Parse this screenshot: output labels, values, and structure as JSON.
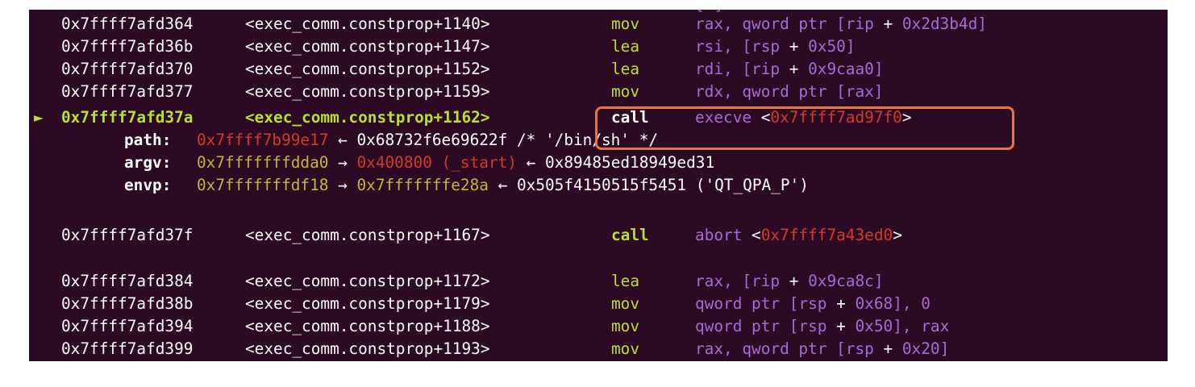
{
  "colors": {
    "background": "#2c0a23",
    "text": "#ffffff",
    "purple": "#a66bd6",
    "red": "#d23a2a",
    "yellow": "#c6b43a",
    "green": "#b8e02c",
    "highlight_box": "#e3753f"
  },
  "cutoff_text": "[ ]",
  "block1": [
    {
      "addr": "0x7ffff7afd364",
      "sym": "<exec_comm.constprop+1140>",
      "mn": "mov",
      "ops": [
        {
          "t": "rax, ",
          "c": "reg"
        },
        {
          "t": "qword ptr [",
          "c": "reg"
        },
        {
          "t": "rip",
          "c": "reg"
        },
        {
          "t": " + ",
          "c": "text"
        },
        {
          "t": "0x2d3b4d",
          "c": "num"
        },
        {
          "t": "]",
          "c": "reg"
        }
      ]
    },
    {
      "addr": "0x7ffff7afd36b",
      "sym": "<exec_comm.constprop+1147>",
      "mn": "lea",
      "ops": [
        {
          "t": "rsi, [",
          "c": "reg"
        },
        {
          "t": "rsp",
          "c": "reg"
        },
        {
          "t": " + ",
          "c": "text"
        },
        {
          "t": "0x50",
          "c": "num"
        },
        {
          "t": "]",
          "c": "reg"
        }
      ]
    },
    {
      "addr": "0x7ffff7afd370",
      "sym": "<exec_comm.constprop+1152>",
      "mn": "lea",
      "ops": [
        {
          "t": "rdi, [",
          "c": "reg"
        },
        {
          "t": "rip",
          "c": "reg"
        },
        {
          "t": " + ",
          "c": "text"
        },
        {
          "t": "0x9caa0",
          "c": "num"
        },
        {
          "t": "]",
          "c": "reg"
        }
      ]
    },
    {
      "addr": "0x7ffff7afd377",
      "sym": "<exec_comm.constprop+1159>",
      "mn": "mov",
      "ops": [
        {
          "t": "rdx, qword ptr [rax]",
          "c": "reg"
        }
      ]
    }
  ],
  "current": {
    "marker": "►",
    "addr": "0x7ffff7afd37a",
    "sym": "<exec_comm.constprop+1162>",
    "mn": "call",
    "target": "execve",
    "open": " <",
    "target_addr": "0x7ffff7ad97f0",
    "close": ">"
  },
  "args": [
    {
      "key": "path:",
      "parts": [
        {
          "t": "0x7ffff7b99e17",
          "c": "red"
        },
        {
          "t": " ← ",
          "c": "text"
        },
        {
          "t": "0x68732f6e69622f /* '/bin/sh' */",
          "c": "text"
        }
      ]
    },
    {
      "key": "argv:",
      "parts": [
        {
          "t": "0x7fffffffdda0",
          "c": "yel"
        },
        {
          "t": " → ",
          "c": "text"
        },
        {
          "t": "0x400800 (_start)",
          "c": "red"
        },
        {
          "t": " ← ",
          "c": "text"
        },
        {
          "t": "0x89485ed18949ed31",
          "c": "text"
        }
      ]
    },
    {
      "key": "envp:",
      "parts": [
        {
          "t": "0x7fffffffdf18",
          "c": "yel"
        },
        {
          "t": " → ",
          "c": "text"
        },
        {
          "t": "0x7fffffffe28a",
          "c": "yel"
        },
        {
          "t": " ← ",
          "c": "text"
        },
        {
          "t": "0x505f4150515f5451 ('QT_QPA_P')",
          "c": "text"
        }
      ]
    }
  ],
  "abort_line": {
    "addr": "0x7ffff7afd37f",
    "sym": "<exec_comm.constprop+1167>",
    "mn": "call",
    "target": "abort",
    "open": " <",
    "target_addr": "0x7ffff7a43ed0",
    "close": ">"
  },
  "block2": [
    {
      "addr": "0x7ffff7afd384",
      "sym": "<exec_comm.constprop+1172>",
      "mn": "lea",
      "ops": [
        {
          "t": "rax, [",
          "c": "reg"
        },
        {
          "t": "rip",
          "c": "reg"
        },
        {
          "t": " + ",
          "c": "text"
        },
        {
          "t": "0x9ca8c",
          "c": "num"
        },
        {
          "t": "]",
          "c": "reg"
        }
      ]
    },
    {
      "addr": "0x7ffff7afd38b",
      "sym": "<exec_comm.constprop+1179>",
      "mn": "mov",
      "ops": [
        {
          "t": "qword ptr [",
          "c": "reg"
        },
        {
          "t": "rsp",
          "c": "reg"
        },
        {
          "t": " + ",
          "c": "text"
        },
        {
          "t": "0x68",
          "c": "num"
        },
        {
          "t": "], ",
          "c": "reg"
        },
        {
          "t": "0",
          "c": "num"
        }
      ]
    },
    {
      "addr": "0x7ffff7afd394",
      "sym": "<exec_comm.constprop+1188>",
      "mn": "mov",
      "ops": [
        {
          "t": "qword ptr [",
          "c": "reg"
        },
        {
          "t": "rsp",
          "c": "reg"
        },
        {
          "t": " + ",
          "c": "text"
        },
        {
          "t": "0x50",
          "c": "num"
        },
        {
          "t": "], ",
          "c": "reg"
        },
        {
          "t": "rax",
          "c": "reg"
        }
      ]
    },
    {
      "addr": "0x7ffff7afd399",
      "sym": "<exec_comm.constprop+1193>",
      "mn": "mov",
      "ops": [
        {
          "t": "rax, qword ptr [",
          "c": "reg"
        },
        {
          "t": "rsp",
          "c": "reg"
        },
        {
          "t": " + ",
          "c": "text"
        },
        {
          "t": "0x20",
          "c": "num"
        },
        {
          "t": "]",
          "c": "reg"
        }
      ]
    }
  ]
}
